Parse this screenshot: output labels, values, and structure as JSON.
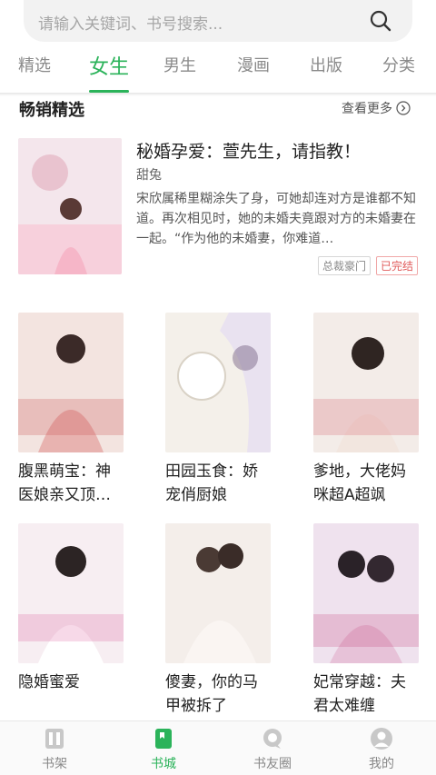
{
  "search": {
    "placeholder": "请输入关键词、书号搜索..."
  },
  "tabs": [
    {
      "label": "精选"
    },
    {
      "label": "女生",
      "active": true
    },
    {
      "label": "男生"
    },
    {
      "label": "漫画"
    },
    {
      "label": "出版"
    },
    {
      "label": "分类"
    }
  ],
  "section": {
    "title": "畅销精选",
    "more": "查看更多"
  },
  "featured": {
    "title": "秘婚孕爱：萱先生，请指教！",
    "author": "甜兔",
    "description": "宋欣属稀里糊涂失了身，可她却连对方是谁都不知道。再次相见时，她的未婚夫竟跟对方的未婚妻在一起。“作为他的未婚妻，你难道…",
    "tags": [
      "总裁豪门",
      "已完结"
    ]
  },
  "books": [
    {
      "title": "腹黑萌宝：神医娘亲又顶…"
    },
    {
      "title": "田园玉食：娇宠俏厨娘"
    },
    {
      "title": "爹地，大佬妈咪超A超飒"
    },
    {
      "title": "隐婚蜜爱"
    },
    {
      "title": "傻妻，你的马甲被拆了"
    },
    {
      "title": "妃常穿越：夫君太难缠"
    }
  ],
  "nav": [
    {
      "label": "书架",
      "icon": "bookshelf-icon"
    },
    {
      "label": "书城",
      "icon": "bookstore-icon",
      "active": true
    },
    {
      "label": "书友圈",
      "icon": "chat-icon"
    },
    {
      "label": "我的",
      "icon": "profile-icon"
    }
  ],
  "colors": {
    "accent": "#2bb35a",
    "tag_done": "#e05a5a"
  }
}
